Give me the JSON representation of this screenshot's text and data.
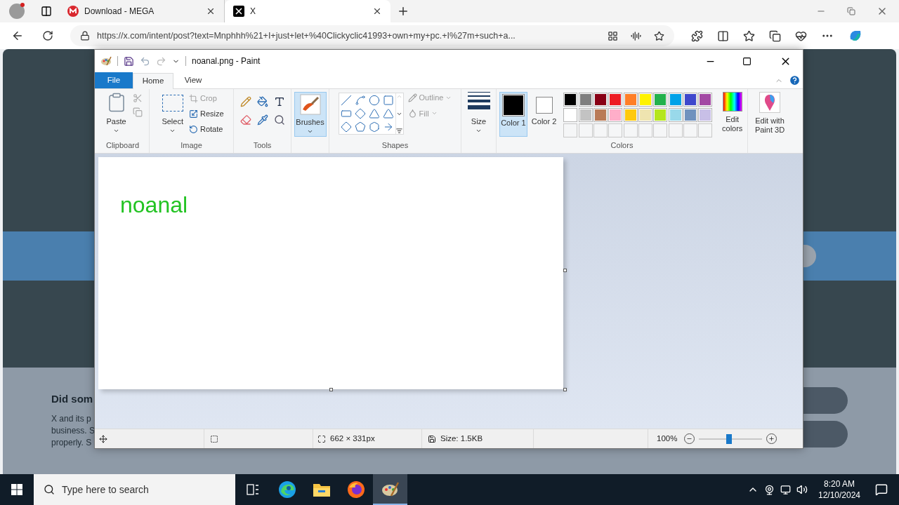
{
  "browser": {
    "tabs": [
      {
        "title": "Download - MEGA",
        "kind": "mega",
        "selected": false
      },
      {
        "title": "X",
        "kind": "x",
        "selected": true
      }
    ],
    "url": "https://x.com/intent/post?text=Mnphhh%21+I+just+let+%40Clickyclic41993+own+my+pc.+I%27m+such+a..."
  },
  "page": {
    "heading": "Did som",
    "lines": [
      "X and its p",
      "business. S",
      "properly. S"
    ]
  },
  "paint": {
    "title": "noanal.png - Paint",
    "tabs": [
      {
        "label": "File",
        "kind": "file",
        "selected": false
      },
      {
        "label": "Home",
        "kind": "tab",
        "selected": true
      },
      {
        "label": "View",
        "kind": "tab",
        "selected": false
      }
    ],
    "ribbon": {
      "paste": "Paste",
      "clipboard_label": "Clipboard",
      "select": "Select",
      "image_buttons": [
        {
          "label": "Crop",
          "kind": "crop",
          "disabled": true
        },
        {
          "label": "Resize",
          "kind": "resize",
          "disabled": false
        },
        {
          "label": "Rotate",
          "kind": "rotate",
          "disabled": false
        }
      ],
      "image_label": "Image",
      "tools_label": "Tools",
      "brushes": {
        "label": "Brushes",
        "selected": true
      },
      "shape_options": [
        {
          "label": "Outline",
          "kind": "outline",
          "disabled": true
        },
        {
          "label": "Fill",
          "kind": "fill",
          "disabled": true
        }
      ],
      "shapes_label": "Shapes",
      "size": "Size",
      "color_slots": [
        {
          "label": "Color 1",
          "color": "#000000",
          "selected": true
        },
        {
          "label": "Color 2",
          "color": "#ffffff",
          "selected": false
        }
      ],
      "palette": [
        {
          "color": "#000000"
        },
        {
          "color": "#7f7f7f"
        },
        {
          "color": "#880015"
        },
        {
          "color": "#ed1c24"
        },
        {
          "color": "#ff7f27"
        },
        {
          "color": "#fff200"
        },
        {
          "color": "#22b14c"
        },
        {
          "color": "#00a2e8"
        },
        {
          "color": "#3f48cc"
        },
        {
          "color": "#a349a4"
        },
        {
          "color": "#ffffff"
        },
        {
          "color": "#c3c3c3"
        },
        {
          "color": "#b97a57"
        },
        {
          "color": "#ffaec9"
        },
        {
          "color": "#ffc90e"
        },
        {
          "color": "#efe4b0"
        },
        {
          "color": "#b5e61d"
        },
        {
          "color": "#99d9ea"
        },
        {
          "color": "#7092be"
        },
        {
          "color": "#c8bfe7"
        }
      ],
      "edit_colors": "Edit colors",
      "colors_label": "Colors",
      "paint3d": "Edit with Paint 3D"
    },
    "canvas": {
      "text": "noanal"
    },
    "status": {
      "dimensions": "662 × 331px",
      "size": "Size: 1.5KB",
      "zoom": "100%",
      "zoom_slider": {
        "level": 0.47
      }
    }
  },
  "taskbar": {
    "search_placeholder": "Type here to search",
    "apps": [
      {
        "kind": "taskview",
        "selected": false
      },
      {
        "kind": "edge",
        "selected": false
      },
      {
        "kind": "explorer",
        "selected": false
      },
      {
        "kind": "firefox",
        "selected": false
      },
      {
        "kind": "paint",
        "selected": true
      }
    ],
    "time": "8:20 AM",
    "date": "12/10/2024"
  }
}
